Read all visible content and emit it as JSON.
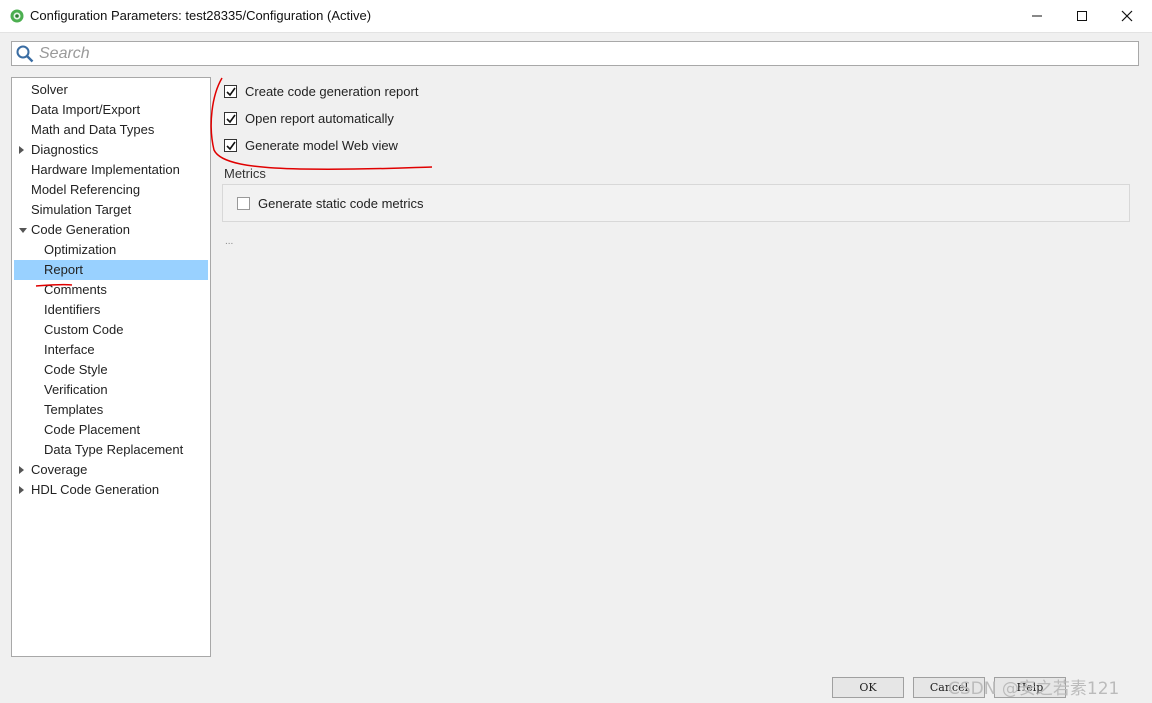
{
  "window": {
    "title": "Configuration Parameters: test28335/Configuration (Active)",
    "icon": "matlab-gear-icon"
  },
  "search": {
    "placeholder": "Search"
  },
  "tree": {
    "items": [
      {
        "label": "Solver",
        "indent": 0,
        "arrow": "none"
      },
      {
        "label": "Data Import/Export",
        "indent": 0,
        "arrow": "none"
      },
      {
        "label": "Math and Data Types",
        "indent": 0,
        "arrow": "none"
      },
      {
        "label": "Diagnostics",
        "indent": 0,
        "arrow": "right"
      },
      {
        "label": "Hardware Implementation",
        "indent": 0,
        "arrow": "none"
      },
      {
        "label": "Model Referencing",
        "indent": 0,
        "arrow": "none"
      },
      {
        "label": "Simulation Target",
        "indent": 0,
        "arrow": "none"
      },
      {
        "label": "Code Generation",
        "indent": 0,
        "arrow": "down"
      },
      {
        "label": "Optimization",
        "indent": 1,
        "arrow": "none"
      },
      {
        "label": "Report",
        "indent": 1,
        "arrow": "none",
        "selected": true
      },
      {
        "label": "Comments",
        "indent": 1,
        "arrow": "none"
      },
      {
        "label": "Identifiers",
        "indent": 1,
        "arrow": "none"
      },
      {
        "label": "Custom Code",
        "indent": 1,
        "arrow": "none"
      },
      {
        "label": "Interface",
        "indent": 1,
        "arrow": "none"
      },
      {
        "label": "Code Style",
        "indent": 1,
        "arrow": "none"
      },
      {
        "label": "Verification",
        "indent": 1,
        "arrow": "none"
      },
      {
        "label": "Templates",
        "indent": 1,
        "arrow": "none"
      },
      {
        "label": "Code Placement",
        "indent": 1,
        "arrow": "none"
      },
      {
        "label": "Data Type Replacement",
        "indent": 1,
        "arrow": "none"
      },
      {
        "label": "Coverage",
        "indent": 0,
        "arrow": "right"
      },
      {
        "label": "HDL Code Generation",
        "indent": 0,
        "arrow": "right"
      }
    ]
  },
  "report": {
    "options": [
      {
        "label": "Create code generation report",
        "checked": true
      },
      {
        "label": "Open report automatically",
        "checked": true
      },
      {
        "label": "Generate model Web view",
        "checked": true
      }
    ],
    "metrics": {
      "title": "Metrics",
      "options": [
        {
          "label": "Generate static code metrics",
          "checked": false
        }
      ]
    },
    "more": "..."
  },
  "buttons": {
    "ok": "OK",
    "cancel": "Cancel",
    "help": "Help"
  },
  "watermark": "CSDN @安之若素121",
  "colors": {
    "selection": "#99d1ff",
    "annotation": "#e00000"
  }
}
